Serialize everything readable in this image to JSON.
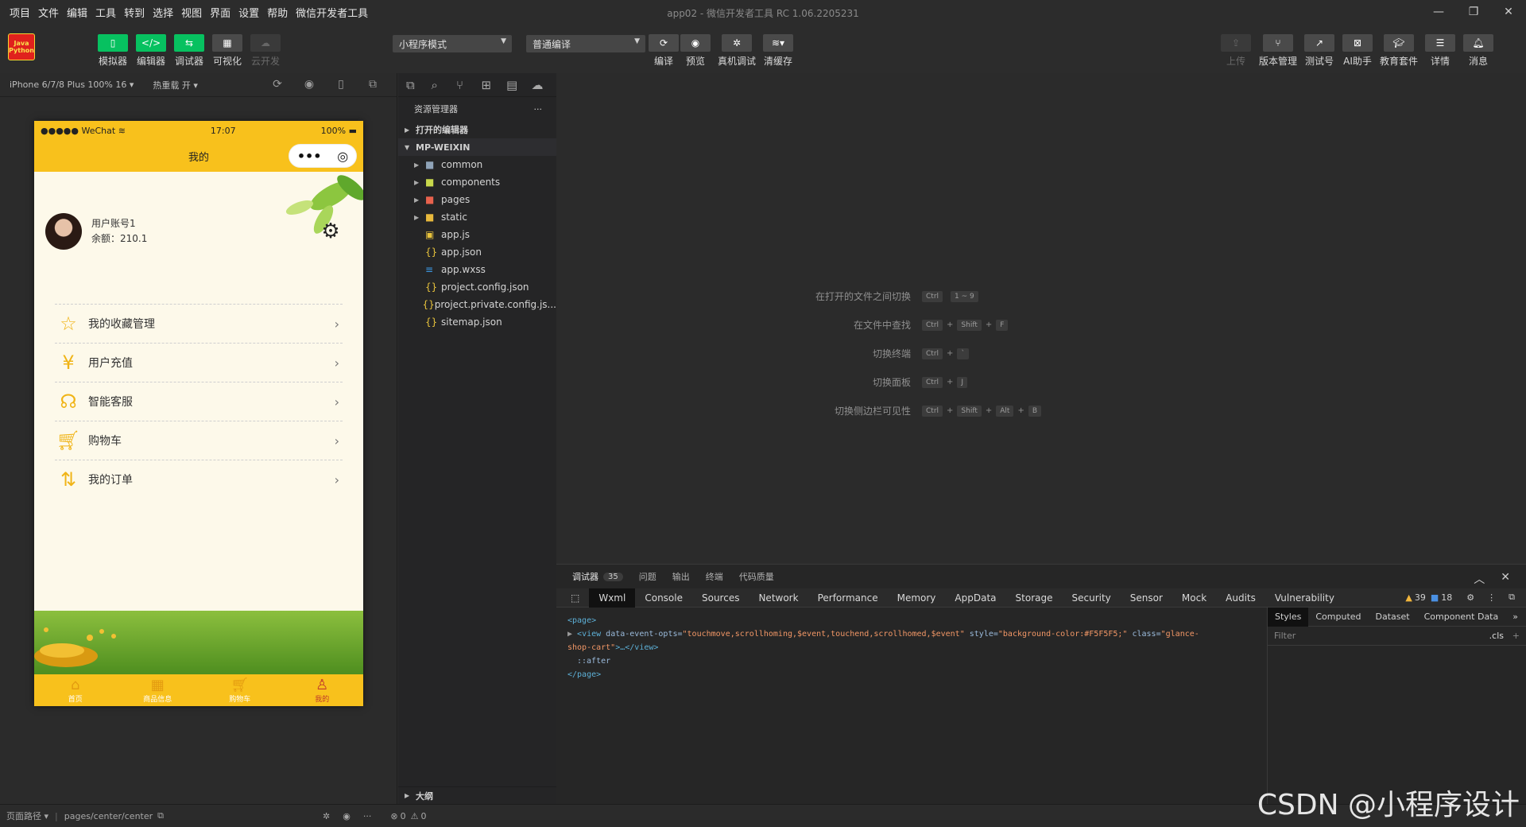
{
  "menu": [
    "项目",
    "文件",
    "编辑",
    "工具",
    "转到",
    "选择",
    "视图",
    "界面",
    "设置",
    "帮助",
    "微信开发者工具"
  ],
  "window_title": "app02 - 微信开发者工具 RC 1.06.2205231",
  "logo_text": [
    "Java",
    "Python"
  ],
  "toolbar": {
    "simulator": "模拟器",
    "editor": "编辑器",
    "debugger": "调试器",
    "visual": "可视化",
    "cloud": "云开发",
    "mode": "小程序模式",
    "compile_mode": "普通编译",
    "compile": "编译",
    "preview": "预览",
    "real_debug": "真机调试",
    "clear_cache": "清缓存",
    "upload": "上传",
    "version": "版本管理",
    "test": "测试号",
    "ai": "AI助手",
    "edu": "教育套件",
    "detail": "详情",
    "msg": "消息"
  },
  "sim": {
    "device": "iPhone 6/7/8 Plus 100% 16 ▾",
    "hot_reload": "热重载 开 ▾"
  },
  "phone": {
    "carrier": "●●●●● WeChat",
    "time": "17:07",
    "battery": "100%",
    "page_title": "我的",
    "account": "用户账号1",
    "balance": "余额：210.1",
    "menu_items": [
      "我的收藏管理",
      "用户充值",
      "智能客服",
      "购物车",
      "我的订单"
    ],
    "tabs": [
      "首页",
      "商品信息",
      "购物车",
      "我的"
    ]
  },
  "explorer": {
    "title": "资源管理器",
    "open_editors": "打开的编辑器",
    "project": "MP-WEIXIN",
    "files": [
      "common",
      "components",
      "pages",
      "static",
      "app.js",
      "app.json",
      "app.wxss",
      "project.config.json",
      "project.private.config.js...",
      "sitemap.json"
    ],
    "outline": "大纲"
  },
  "shortcuts": [
    {
      "label": "在打开的文件之间切换",
      "keys": [
        "Ctrl",
        "1 ~ 9"
      ]
    },
    {
      "label": "在文件中查找",
      "keys": [
        "Ctrl",
        "Shift",
        "F"
      ]
    },
    {
      "label": "切换终端",
      "keys": [
        "Ctrl",
        "`"
      ]
    },
    {
      "label": "切换面板",
      "keys": [
        "Ctrl",
        "J"
      ]
    },
    {
      "label": "切换侧边栏可见性",
      "keys": [
        "Ctrl",
        "Shift",
        "Alt",
        "B"
      ]
    }
  ],
  "debug": {
    "tabs": [
      "调试器",
      "问题",
      "输出",
      "终端",
      "代码质量"
    ],
    "count": "35",
    "panel_tabs": [
      "Wxml",
      "Console",
      "Sources",
      "Network",
      "Performance",
      "Memory",
      "AppData",
      "Storage",
      "Security",
      "Sensor",
      "Mock",
      "Audits",
      "Vulnerability"
    ],
    "warnings": "39",
    "infos": "18",
    "dom": {
      "page_open": "<page>",
      "view_tag": "<view",
      "attr1_name": " data-event-opts=",
      "attr1_val": "\"touchmove,scrollhoming,$event,touchend,scrollhomed,$event\"",
      "attr2_name": " style=",
      "attr2_val": "\"background-color:#F5F5F5;\"",
      "attr3_name": " class=",
      "attr3_val": "\"glance-",
      "attr3_val2": "shop-cart\"",
      "view_close": ">…</view>",
      "after": "::after",
      "page_close": "</page>"
    },
    "style_tabs": [
      "Styles",
      "Computed",
      "Dataset",
      "Component Data"
    ],
    "filter": "Filter",
    "cls": ".cls"
  },
  "status": {
    "path_label": "页面路径 ▾",
    "path": "pages/center/center",
    "errors": "0",
    "warns": "0"
  },
  "watermark": "CSDN @小程序设计"
}
